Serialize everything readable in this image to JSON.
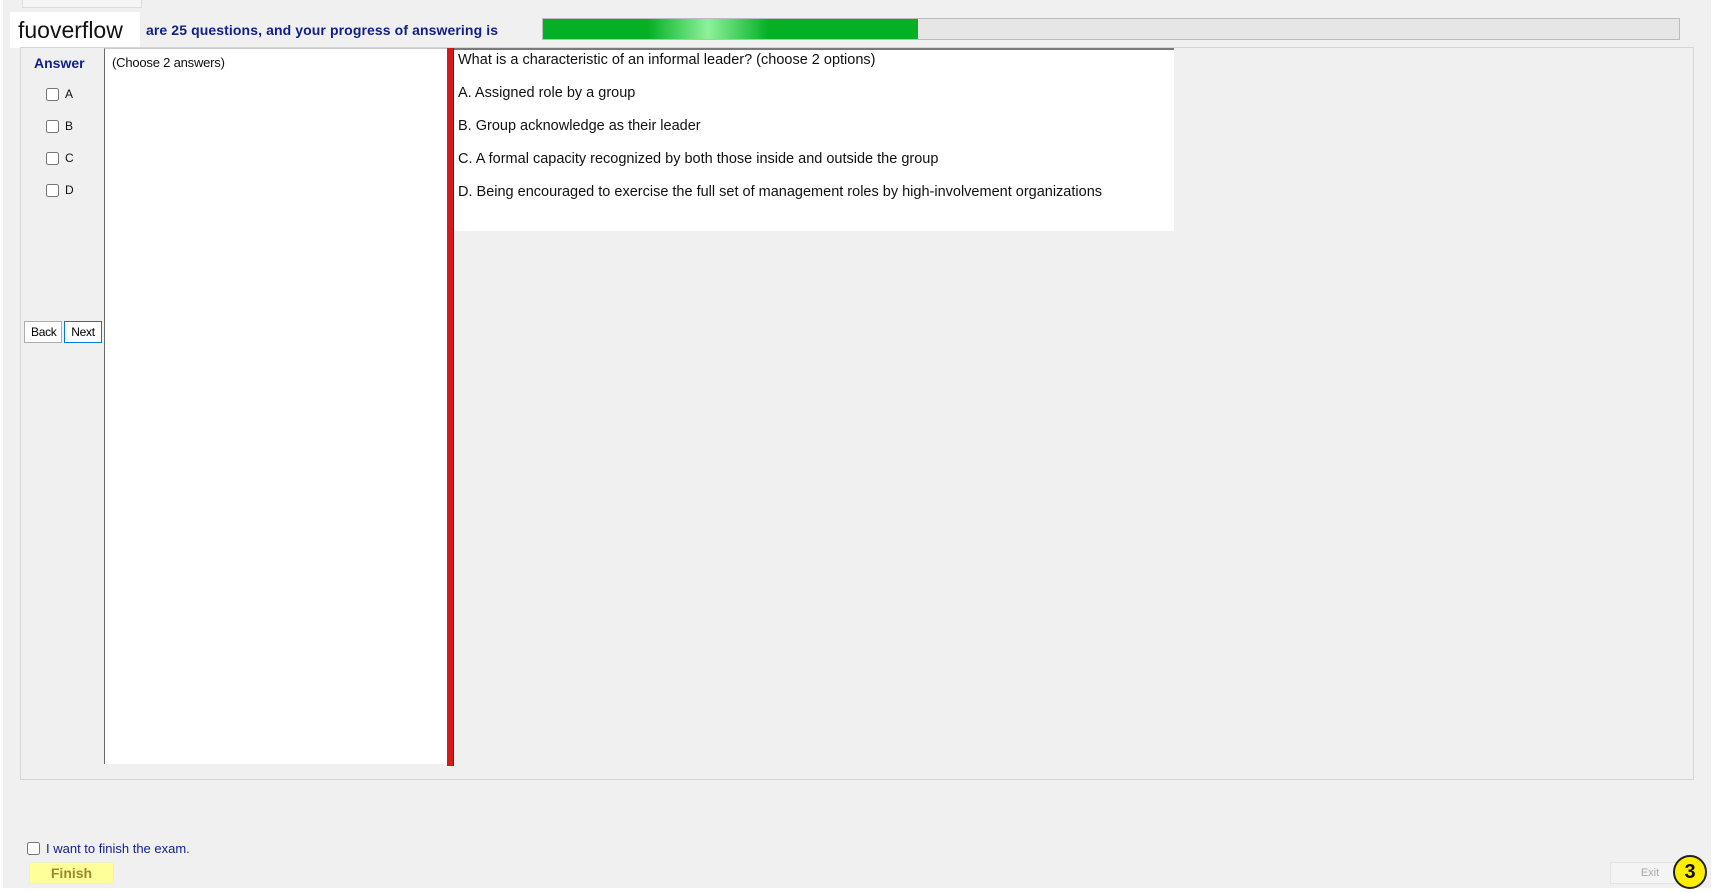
{
  "watermark": "fuoverflow",
  "progress": {
    "text": "are 25 questions, and your progress of answering is",
    "fraction": 0.33
  },
  "answer_panel": {
    "label": "Answer",
    "options": [
      "A",
      "B",
      "C",
      "D"
    ]
  },
  "nav": {
    "back_label": "Back",
    "next_label": "Next"
  },
  "hint": "(Choose 2 answers)",
  "question": {
    "title": "What is a characteristic of an informal leader? (choose 2 options)",
    "choices": [
      "A.  Assigned role by a group",
      "B.  Group acknowledge as their leader",
      "C.  A formal capacity recognized by both those inside and outside the group",
      "D.  Being encouraged to exercise the full set of management roles by high-involvement organizations"
    ]
  },
  "footer": {
    "finish_checkbox_label": "I want to finish the exam.",
    "finish_label": "Finish",
    "exit_label": "Exit",
    "badge": "3"
  }
}
